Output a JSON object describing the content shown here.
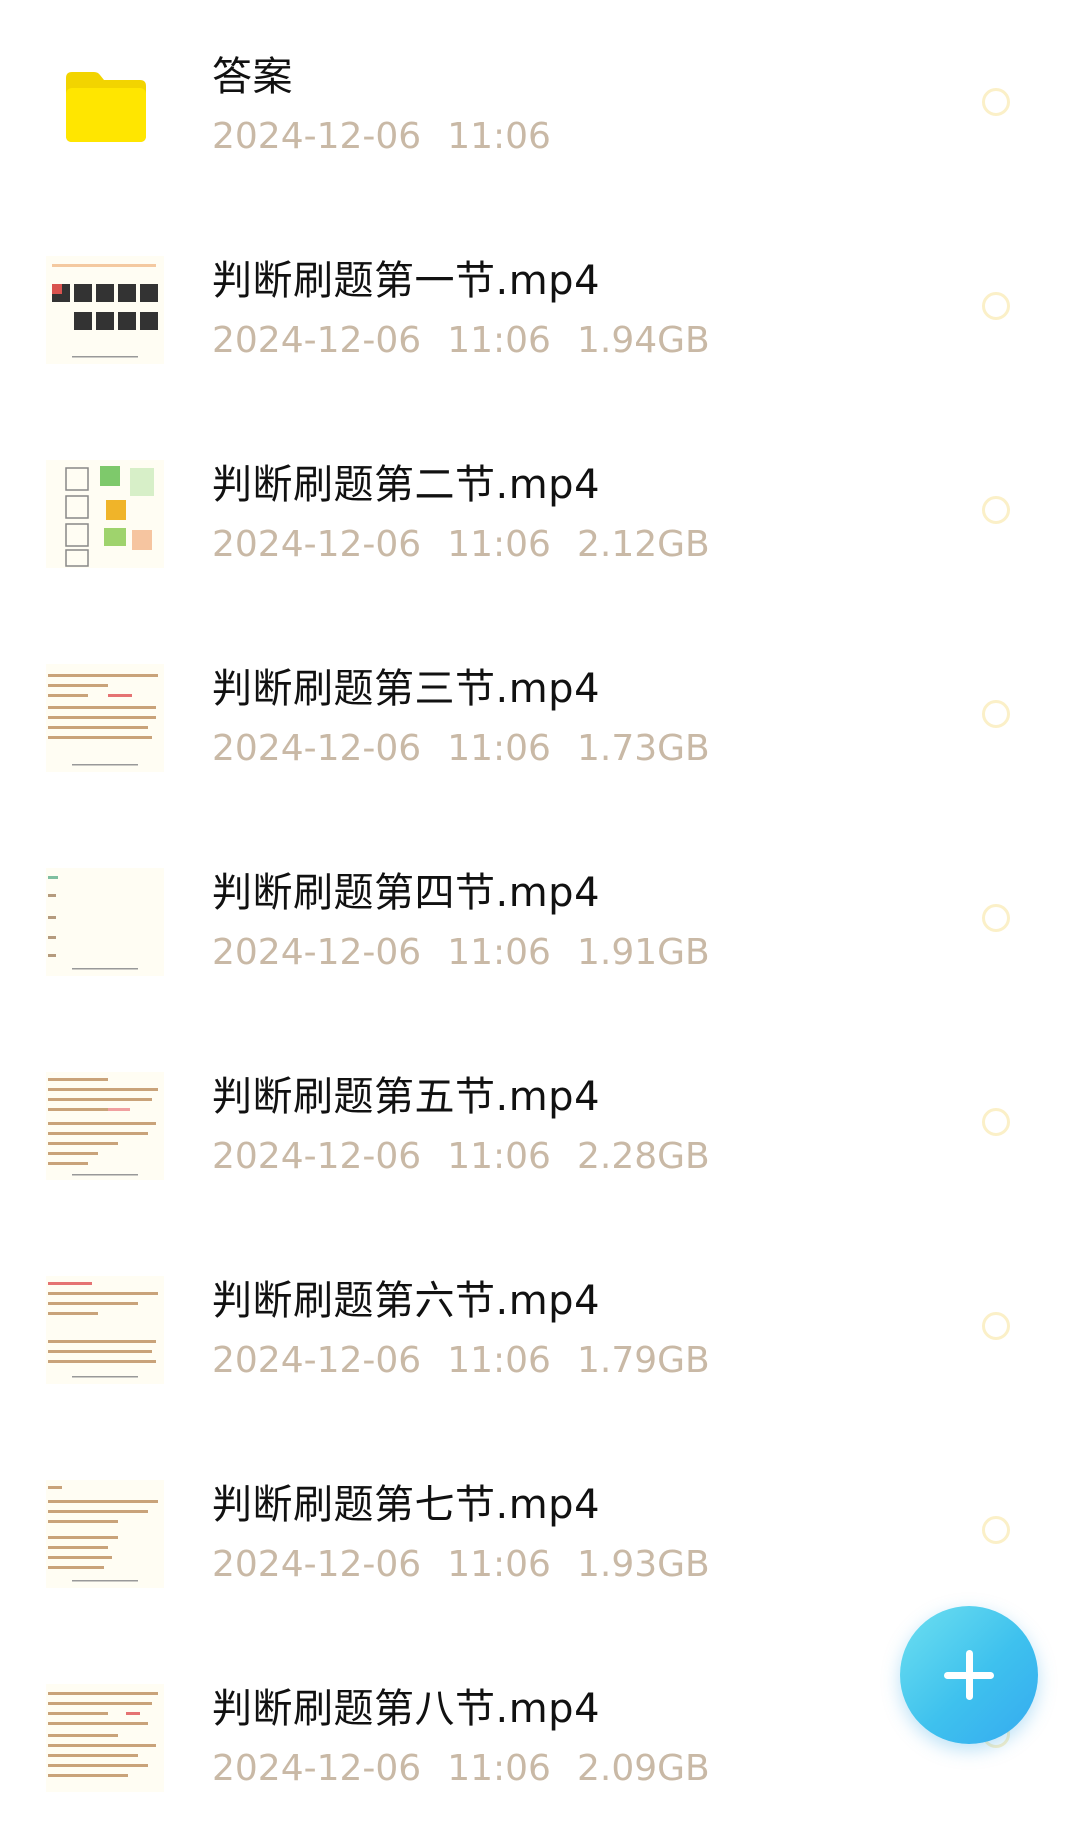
{
  "files": [
    {
      "name": "答案",
      "date": "2024-12-06",
      "time": "11:06",
      "size": "",
      "type": "folder"
    },
    {
      "name": "判断刷题第一节.mp4",
      "date": "2024-12-06",
      "time": "11:06",
      "size": "1.94GB",
      "type": "video"
    },
    {
      "name": "判断刷题第二节.mp4",
      "date": "2024-12-06",
      "time": "11:06",
      "size": "2.12GB",
      "type": "video"
    },
    {
      "name": "判断刷题第三节.mp4",
      "date": "2024-12-06",
      "time": "11:06",
      "size": "1.73GB",
      "type": "video"
    },
    {
      "name": "判断刷题第四节.mp4",
      "date": "2024-12-06",
      "time": "11:06",
      "size": "1.91GB",
      "type": "video"
    },
    {
      "name": "判断刷题第五节.mp4",
      "date": "2024-12-06",
      "time": "11:06",
      "size": "2.28GB",
      "type": "video"
    },
    {
      "name": "判断刷题第六节.mp4",
      "date": "2024-12-06",
      "time": "11:06",
      "size": "1.79GB",
      "type": "video"
    },
    {
      "name": "判断刷题第七节.mp4",
      "date": "2024-12-06",
      "time": "11:06",
      "size": "1.93GB",
      "type": "video"
    },
    {
      "name": "判断刷题第八节.mp4",
      "date": "2024-12-06",
      "time": "11:06",
      "size": "2.09GB",
      "type": "video"
    }
  ],
  "icons": {
    "folder": "folder-icon",
    "fab": "plus-icon"
  },
  "colors": {
    "folder": "#ffe600",
    "meta_text": "#c9b9a6",
    "fab": "#3ec1ee"
  }
}
